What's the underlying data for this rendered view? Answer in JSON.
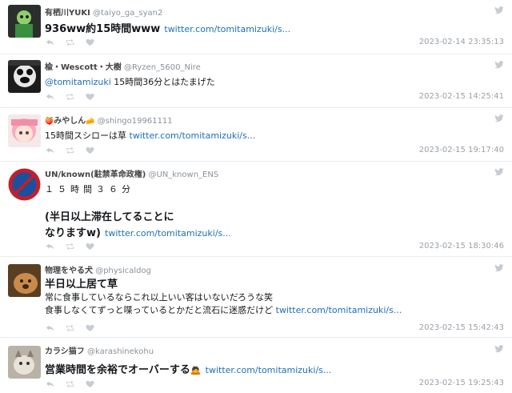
{
  "tweets": [
    {
      "name": "有栖川YUKI",
      "handle": "@taiyo_ga_syan2",
      "line1": "936ww約15時間www",
      "link": "twitter.com/tomitamizuki/s...",
      "time": "2023-02-14 23:35:13"
    },
    {
      "name": "楡・Wescott・大樹",
      "handle": "@Ryzen_5600_Nire",
      "mention": "@tomitamizuki",
      "line1": " 15時間36分とはたまげた",
      "time": "2023-02-15 14:25:41"
    },
    {
      "emoji": "🍑",
      "name": "みやしん",
      "emoji2": "🧀",
      "handle": "@shingo19961111",
      "line1": "15時間スシローは草 ",
      "link": "twitter.com/tomitamizuki/s...",
      "time": "2023-02-15 19:17:40"
    },
    {
      "name": "UN/known(駐禁革命政権)",
      "handle": "@UN_known_ENS",
      "line1": "１５時間３６分",
      "line2": "(半日以上滞在してることに",
      "line3": "なりますw)",
      "link": "twitter.com/tomitamizuki/s...",
      "time": "2023-02-15 18:30:46"
    },
    {
      "name": "物理をやる犬",
      "handle": "@physicaldog",
      "line1": "半日以上居て草",
      "line2": "常に食事しているならこれ以上いい客はいないだろうな笑",
      "line3": "食事しなくてずっと喋っているとかだと流石に迷惑だけど ",
      "link": "twitter.com/tomitamizuki/s...",
      "time": "2023-02-15 15:42:43"
    },
    {
      "name": "カラシ猫フ",
      "handle": "@karashinekohu",
      "line1": "営業時間を余裕でオーバーする",
      "emoji": "🙇",
      "link": "twitter.com/tomitamizuki/s...",
      "time": "2023-02-15 19:25:43"
    }
  ]
}
